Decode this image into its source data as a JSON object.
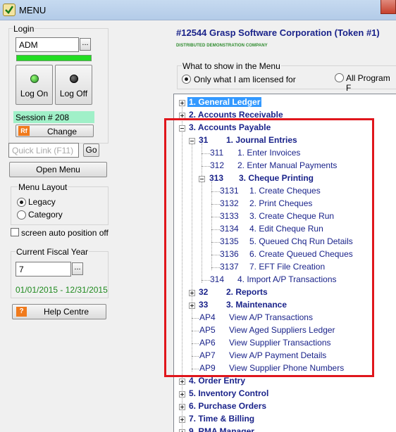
{
  "window": {
    "title": "MENU"
  },
  "login": {
    "group_label": "Login",
    "user_value": "ADM",
    "ellipsis": "...",
    "log_on_label": "Log On",
    "log_off_label": "Log Off",
    "session_text": "Session # 208",
    "change_icon": "Rf",
    "change_label": "Change"
  },
  "quick_link": {
    "placeholder": "Quick Link (F11)",
    "go_label": "Go"
  },
  "open_menu_label": "Open Menu",
  "menu_layout": {
    "group_label": "Menu Layout",
    "options": [
      "Legacy",
      "Category"
    ],
    "selected": "Legacy"
  },
  "screen_auto_position_label": "screen auto position off",
  "fiscal_year": {
    "group_label": "Current Fiscal Year",
    "value": "7",
    "ellipsis": "...",
    "range": "01/01/2015 - 12/31/2015"
  },
  "help": {
    "icon": "?",
    "label": "Help Centre"
  },
  "company": {
    "name": "#12544  Grasp Software Corporation (Token #1)",
    "subtitle": "DISTRIBUTED DEMONSTRATION COMPANY"
  },
  "what_to_show": {
    "group_label": "What to show in the Menu",
    "option_licensed": "Only what I am licensed for",
    "option_all": "All Program F",
    "selected": "licensed"
  },
  "tree": {
    "n1": "1. General Ledger",
    "n2": "2. Accounts Receivable",
    "n3": "3. Accounts Payable",
    "n31_code": "31",
    "n31_label": "1. Journal Entries",
    "n311_code": "311",
    "n311_label": "1. Enter Invoices",
    "n312_code": "312",
    "n312_label": "2. Enter Manual Payments",
    "n313_code": "313",
    "n313_label": "3. Cheque Printing",
    "n3131_code": "3131",
    "n3131_label": "1. Create Cheques",
    "n3132_code": "3132",
    "n3132_label": "2. Print Cheques",
    "n3133_code": "3133",
    "n3133_label": "3. Create Cheque Run",
    "n3134_code": "3134",
    "n3134_label": "4. Edit Cheque Run",
    "n3135_code": "3135",
    "n3135_label": "5. Queued Chq Run Details",
    "n3136_code": "3136",
    "n3136_label": "6. Create Queued Cheques",
    "n3137_code": "3137",
    "n3137_label": "7. EFT File Creation",
    "n314_code": "314",
    "n314_label": "4. Import A/P Transactions",
    "n32_code": "32",
    "n32_label": "2. Reports",
    "n33_code": "33",
    "n33_label": "3. Maintenance",
    "ap4_code": "AP4",
    "ap4_label": "View A/P Transactions",
    "ap5_code": "AP5",
    "ap5_label": "View Aged Suppliers Ledger",
    "ap6_code": "AP6",
    "ap6_label": "View Supplier Transactions",
    "ap7_code": "AP7",
    "ap7_label": "View A/P Payment Details",
    "ap9_code": "AP9",
    "ap9_label": "View Supplier Phone Numbers",
    "n4": "4. Order Entry",
    "n5": "5. Inventory Control",
    "n6": "6. Purchase Orders",
    "n7": "7. Time & Billing",
    "n9": "9. RMA Manager"
  },
  "colors": {
    "tree_text": "#1a238a",
    "selection": "#3399ff",
    "highlight_border": "#e0161c",
    "session_bg": "#a0f0c8",
    "progress_green": "#22dd22",
    "fiscal_range_text": "#1f8a1f",
    "subtitle_green": "#2c8a2c"
  }
}
